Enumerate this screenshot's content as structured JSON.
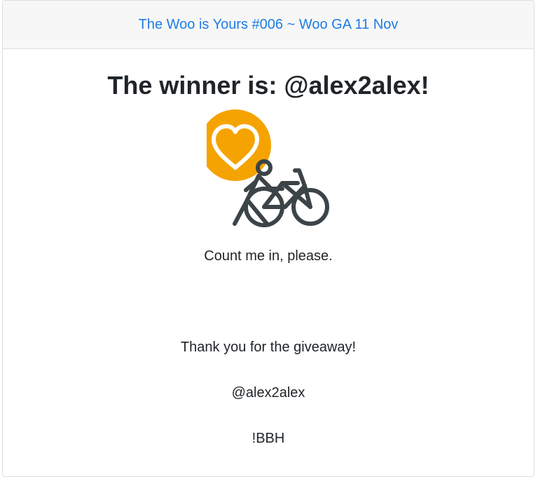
{
  "header": {
    "link_text": "The Woo is Yours #006 ~ Woo GA 11 Nov"
  },
  "main": {
    "title": "The winner is: @alex2alex!",
    "illustration_icons": [
      "heart-badge-icon",
      "person-walking-bike-icon"
    ],
    "messages": {
      "line1": "Count me in, please.",
      "line2": "Thank you for the giveaway!",
      "line3": "@alex2alex",
      "line4": "!BBH"
    }
  },
  "colors": {
    "link": "#1e7ce6",
    "badge": "#f5a300",
    "icon_stroke": "#3c4448",
    "text": "#212529",
    "header_bg": "#f7f7f7"
  }
}
